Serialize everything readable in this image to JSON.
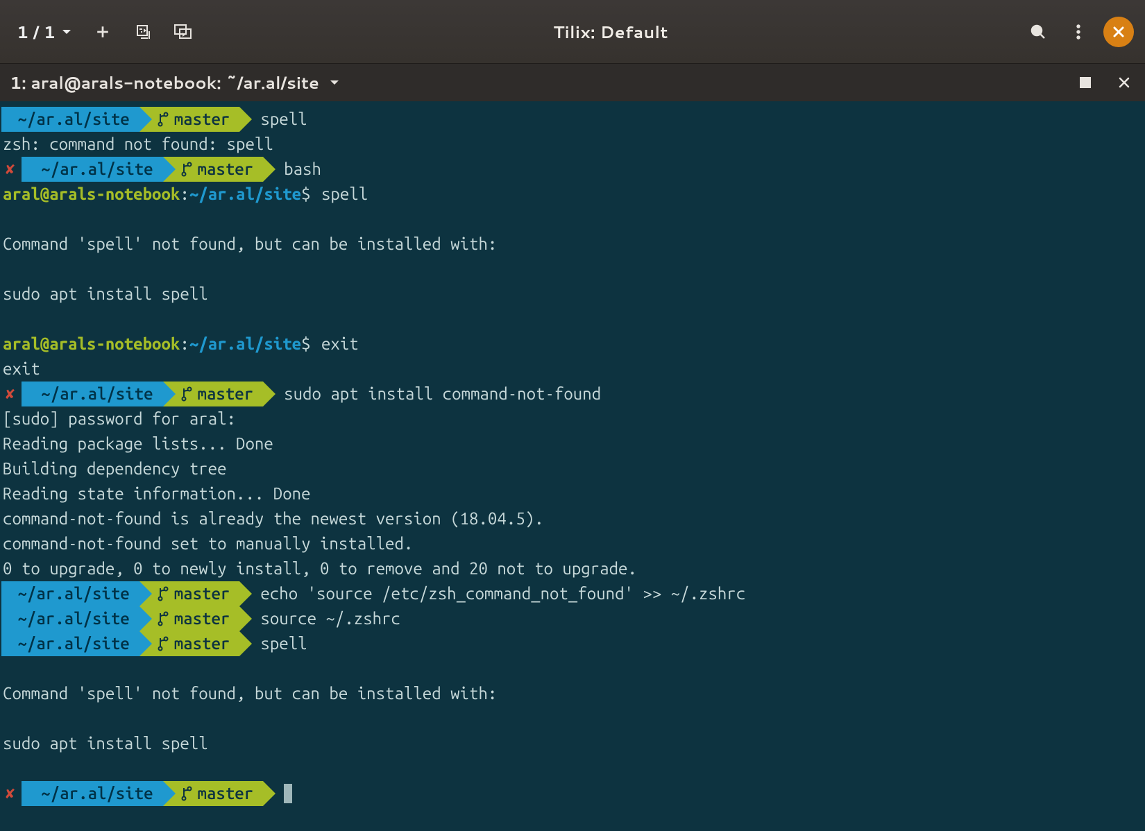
{
  "colors": {
    "headerbar": "#3c3836",
    "terminal_bg": "#0d3340",
    "seg_blue": "#1f99cf",
    "seg_green": "#a6be27",
    "accent_orange": "#d88014",
    "error_red": "#d04a3a"
  },
  "header": {
    "session_counter": "1 / 1",
    "title": "Tilix: Default"
  },
  "pane": {
    "title": "1: aral@arals-notebook: ~/ar.al/site"
  },
  "prompt": {
    "path": "~/ar.al/site",
    "branch": "master",
    "error_glyph": "✘"
  },
  "bash_prompt": {
    "user_host": "aral@arals-notebook",
    "path": "~/ar.al/site",
    "sigil": "$"
  },
  "lines": [
    {
      "type": "zsh_prompt",
      "error": false,
      "cmd": "spell"
    },
    {
      "type": "out",
      "text": "zsh: command not found: spell"
    },
    {
      "type": "zsh_prompt",
      "error": true,
      "cmd": "bash"
    },
    {
      "type": "bash_prompt",
      "cmd": "spell"
    },
    {
      "type": "blank"
    },
    {
      "type": "out",
      "text": "Command 'spell' not found, but can be installed with:"
    },
    {
      "type": "blank"
    },
    {
      "type": "out",
      "text": "sudo apt install spell"
    },
    {
      "type": "blank"
    },
    {
      "type": "bash_prompt",
      "cmd": "exit"
    },
    {
      "type": "out",
      "text": "exit"
    },
    {
      "type": "zsh_prompt",
      "error": true,
      "cmd": "sudo apt install command-not-found"
    },
    {
      "type": "out",
      "text": "[sudo] password for aral: "
    },
    {
      "type": "out",
      "text": "Reading package lists... Done"
    },
    {
      "type": "out",
      "text": "Building dependency tree       "
    },
    {
      "type": "out",
      "text": "Reading state information... Done"
    },
    {
      "type": "out",
      "text": "command-not-found is already the newest version (18.04.5)."
    },
    {
      "type": "out",
      "text": "command-not-found set to manually installed."
    },
    {
      "type": "out",
      "text": "0 to upgrade, 0 to newly install, 0 to remove and 20 not to upgrade."
    },
    {
      "type": "zsh_prompt",
      "error": false,
      "cmd": "echo 'source /etc/zsh_command_not_found' >> ~/.zshrc"
    },
    {
      "type": "zsh_prompt",
      "error": false,
      "cmd": "source ~/.zshrc"
    },
    {
      "type": "zsh_prompt",
      "error": false,
      "cmd": "spell"
    },
    {
      "type": "blank"
    },
    {
      "type": "out",
      "text": "Command 'spell' not found, but can be installed with:"
    },
    {
      "type": "blank"
    },
    {
      "type": "out",
      "text": "sudo apt install spell"
    },
    {
      "type": "blank"
    },
    {
      "type": "zsh_prompt",
      "error": true,
      "cmd": "",
      "cursor": true
    }
  ]
}
